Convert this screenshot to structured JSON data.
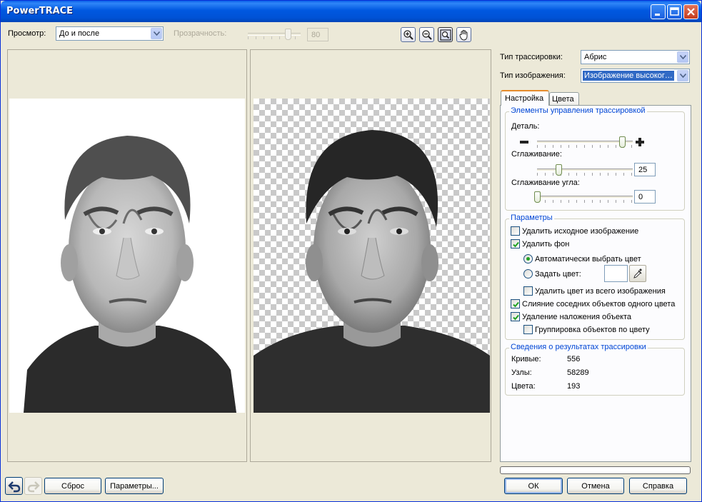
{
  "window": {
    "title": "PowerTRACE",
    "minimize_icon": "minimize-icon",
    "maximize_icon": "maximize-icon",
    "close_icon": "close-icon"
  },
  "toolbar": {
    "preview_label": "Просмотр:",
    "preview_value": "До и после",
    "transparency_label": "Прозрачность:",
    "transparency_value": "80",
    "transparency_level_percent": 80,
    "tools": [
      "zoom-in-icon",
      "zoom-out-icon",
      "fit-to-window-icon",
      "pan-hand-icon"
    ]
  },
  "trace": {
    "trace_type_label": "Тип трассировки:",
    "trace_type_value": "Абрис",
    "image_type_label": "Тип изображения:",
    "image_type_value": "Изображение высоког…"
  },
  "tabs": [
    {
      "label": "Настройка",
      "active": true
    },
    {
      "label": "Цвета",
      "active": false
    }
  ],
  "trace_controls": {
    "legend": "Элементы управления трассировкой",
    "detail_label": "Деталь:",
    "detail_level_percent": 92,
    "smoothing_label": "Сглаживание:",
    "smoothing_value": "25",
    "corner_smoothing_label": "Сглаживание угла:",
    "corner_smoothing_value": "0"
  },
  "options": {
    "legend": "Параметры",
    "delete_original": {
      "label": "Удалить исходное изображение",
      "checked": false
    },
    "remove_background": {
      "label": "Удалить фон",
      "checked": true
    },
    "auto_color": {
      "label": "Автоматически выбрать цвет",
      "selected": true
    },
    "specify_color": {
      "label": "Задать цвет:",
      "selected": false
    },
    "remove_color_entire": {
      "label": "Удалить цвет из всего изображения",
      "checked": false
    },
    "merge_adjacent": {
      "label": "Слияние соседних объектов одного цвета",
      "checked": true
    },
    "remove_overlap": {
      "label": "Удаление наложения объекта",
      "checked": true
    },
    "group_by_color": {
      "label": "Группировка объектов по цвету",
      "checked": false
    },
    "eyedropper_icon": "eyedropper-icon"
  },
  "results": {
    "legend": "Сведения о результатах трассировки",
    "curves_label": "Кривые:",
    "curves_value": "556",
    "nodes_label": "Узлы:",
    "nodes_value": "58289",
    "colors_label": "Цвета:",
    "colors_value": "193"
  },
  "buttons": {
    "undo_icon": "undo-icon",
    "redo_icon": "redo-icon",
    "reset": "Сброс",
    "options": "Параметры...",
    "ok": "ОК",
    "cancel": "Отмена",
    "help": "Справка"
  },
  "colors": {
    "title_bar": "#0055e5",
    "accent_tab": "#e68b2c",
    "group_legend": "#0046d5",
    "selection": "#316ac5"
  }
}
